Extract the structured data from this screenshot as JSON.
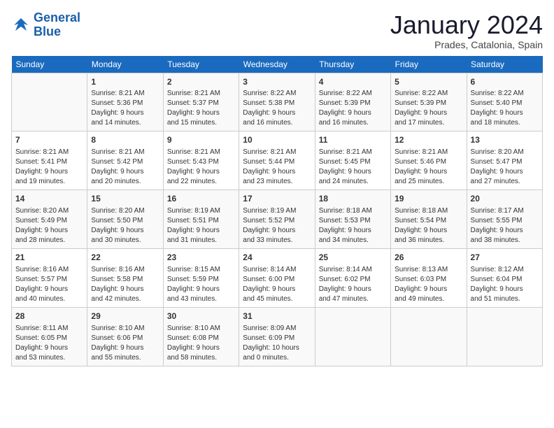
{
  "logo": {
    "line1": "General",
    "line2": "Blue"
  },
  "title": "January 2024",
  "location": "Prades, Catalonia, Spain",
  "days_of_week": [
    "Sunday",
    "Monday",
    "Tuesday",
    "Wednesday",
    "Thursday",
    "Friday",
    "Saturday"
  ],
  "weeks": [
    [
      {
        "day": "",
        "info": ""
      },
      {
        "day": "1",
        "info": "Sunrise: 8:21 AM\nSunset: 5:36 PM\nDaylight: 9 hours\nand 14 minutes."
      },
      {
        "day": "2",
        "info": "Sunrise: 8:21 AM\nSunset: 5:37 PM\nDaylight: 9 hours\nand 15 minutes."
      },
      {
        "day": "3",
        "info": "Sunrise: 8:22 AM\nSunset: 5:38 PM\nDaylight: 9 hours\nand 16 minutes."
      },
      {
        "day": "4",
        "info": "Sunrise: 8:22 AM\nSunset: 5:39 PM\nDaylight: 9 hours\nand 16 minutes."
      },
      {
        "day": "5",
        "info": "Sunrise: 8:22 AM\nSunset: 5:39 PM\nDaylight: 9 hours\nand 17 minutes."
      },
      {
        "day": "6",
        "info": "Sunrise: 8:22 AM\nSunset: 5:40 PM\nDaylight: 9 hours\nand 18 minutes."
      }
    ],
    [
      {
        "day": "7",
        "info": "Sunrise: 8:21 AM\nSunset: 5:41 PM\nDaylight: 9 hours\nand 19 minutes."
      },
      {
        "day": "8",
        "info": "Sunrise: 8:21 AM\nSunset: 5:42 PM\nDaylight: 9 hours\nand 20 minutes."
      },
      {
        "day": "9",
        "info": "Sunrise: 8:21 AM\nSunset: 5:43 PM\nDaylight: 9 hours\nand 22 minutes."
      },
      {
        "day": "10",
        "info": "Sunrise: 8:21 AM\nSunset: 5:44 PM\nDaylight: 9 hours\nand 23 minutes."
      },
      {
        "day": "11",
        "info": "Sunrise: 8:21 AM\nSunset: 5:45 PM\nDaylight: 9 hours\nand 24 minutes."
      },
      {
        "day": "12",
        "info": "Sunrise: 8:21 AM\nSunset: 5:46 PM\nDaylight: 9 hours\nand 25 minutes."
      },
      {
        "day": "13",
        "info": "Sunrise: 8:20 AM\nSunset: 5:47 PM\nDaylight: 9 hours\nand 27 minutes."
      }
    ],
    [
      {
        "day": "14",
        "info": "Sunrise: 8:20 AM\nSunset: 5:49 PM\nDaylight: 9 hours\nand 28 minutes."
      },
      {
        "day": "15",
        "info": "Sunrise: 8:20 AM\nSunset: 5:50 PM\nDaylight: 9 hours\nand 30 minutes."
      },
      {
        "day": "16",
        "info": "Sunrise: 8:19 AM\nSunset: 5:51 PM\nDaylight: 9 hours\nand 31 minutes."
      },
      {
        "day": "17",
        "info": "Sunrise: 8:19 AM\nSunset: 5:52 PM\nDaylight: 9 hours\nand 33 minutes."
      },
      {
        "day": "18",
        "info": "Sunrise: 8:18 AM\nSunset: 5:53 PM\nDaylight: 9 hours\nand 34 minutes."
      },
      {
        "day": "19",
        "info": "Sunrise: 8:18 AM\nSunset: 5:54 PM\nDaylight: 9 hours\nand 36 minutes."
      },
      {
        "day": "20",
        "info": "Sunrise: 8:17 AM\nSunset: 5:55 PM\nDaylight: 9 hours\nand 38 minutes."
      }
    ],
    [
      {
        "day": "21",
        "info": "Sunrise: 8:16 AM\nSunset: 5:57 PM\nDaylight: 9 hours\nand 40 minutes."
      },
      {
        "day": "22",
        "info": "Sunrise: 8:16 AM\nSunset: 5:58 PM\nDaylight: 9 hours\nand 42 minutes."
      },
      {
        "day": "23",
        "info": "Sunrise: 8:15 AM\nSunset: 5:59 PM\nDaylight: 9 hours\nand 43 minutes."
      },
      {
        "day": "24",
        "info": "Sunrise: 8:14 AM\nSunset: 6:00 PM\nDaylight: 9 hours\nand 45 minutes."
      },
      {
        "day": "25",
        "info": "Sunrise: 8:14 AM\nSunset: 6:02 PM\nDaylight: 9 hours\nand 47 minutes."
      },
      {
        "day": "26",
        "info": "Sunrise: 8:13 AM\nSunset: 6:03 PM\nDaylight: 9 hours\nand 49 minutes."
      },
      {
        "day": "27",
        "info": "Sunrise: 8:12 AM\nSunset: 6:04 PM\nDaylight: 9 hours\nand 51 minutes."
      }
    ],
    [
      {
        "day": "28",
        "info": "Sunrise: 8:11 AM\nSunset: 6:05 PM\nDaylight: 9 hours\nand 53 minutes."
      },
      {
        "day": "29",
        "info": "Sunrise: 8:10 AM\nSunset: 6:06 PM\nDaylight: 9 hours\nand 55 minutes."
      },
      {
        "day": "30",
        "info": "Sunrise: 8:10 AM\nSunset: 6:08 PM\nDaylight: 9 hours\nand 58 minutes."
      },
      {
        "day": "31",
        "info": "Sunrise: 8:09 AM\nSunset: 6:09 PM\nDaylight: 10 hours\nand 0 minutes."
      },
      {
        "day": "",
        "info": ""
      },
      {
        "day": "",
        "info": ""
      },
      {
        "day": "",
        "info": ""
      }
    ]
  ]
}
